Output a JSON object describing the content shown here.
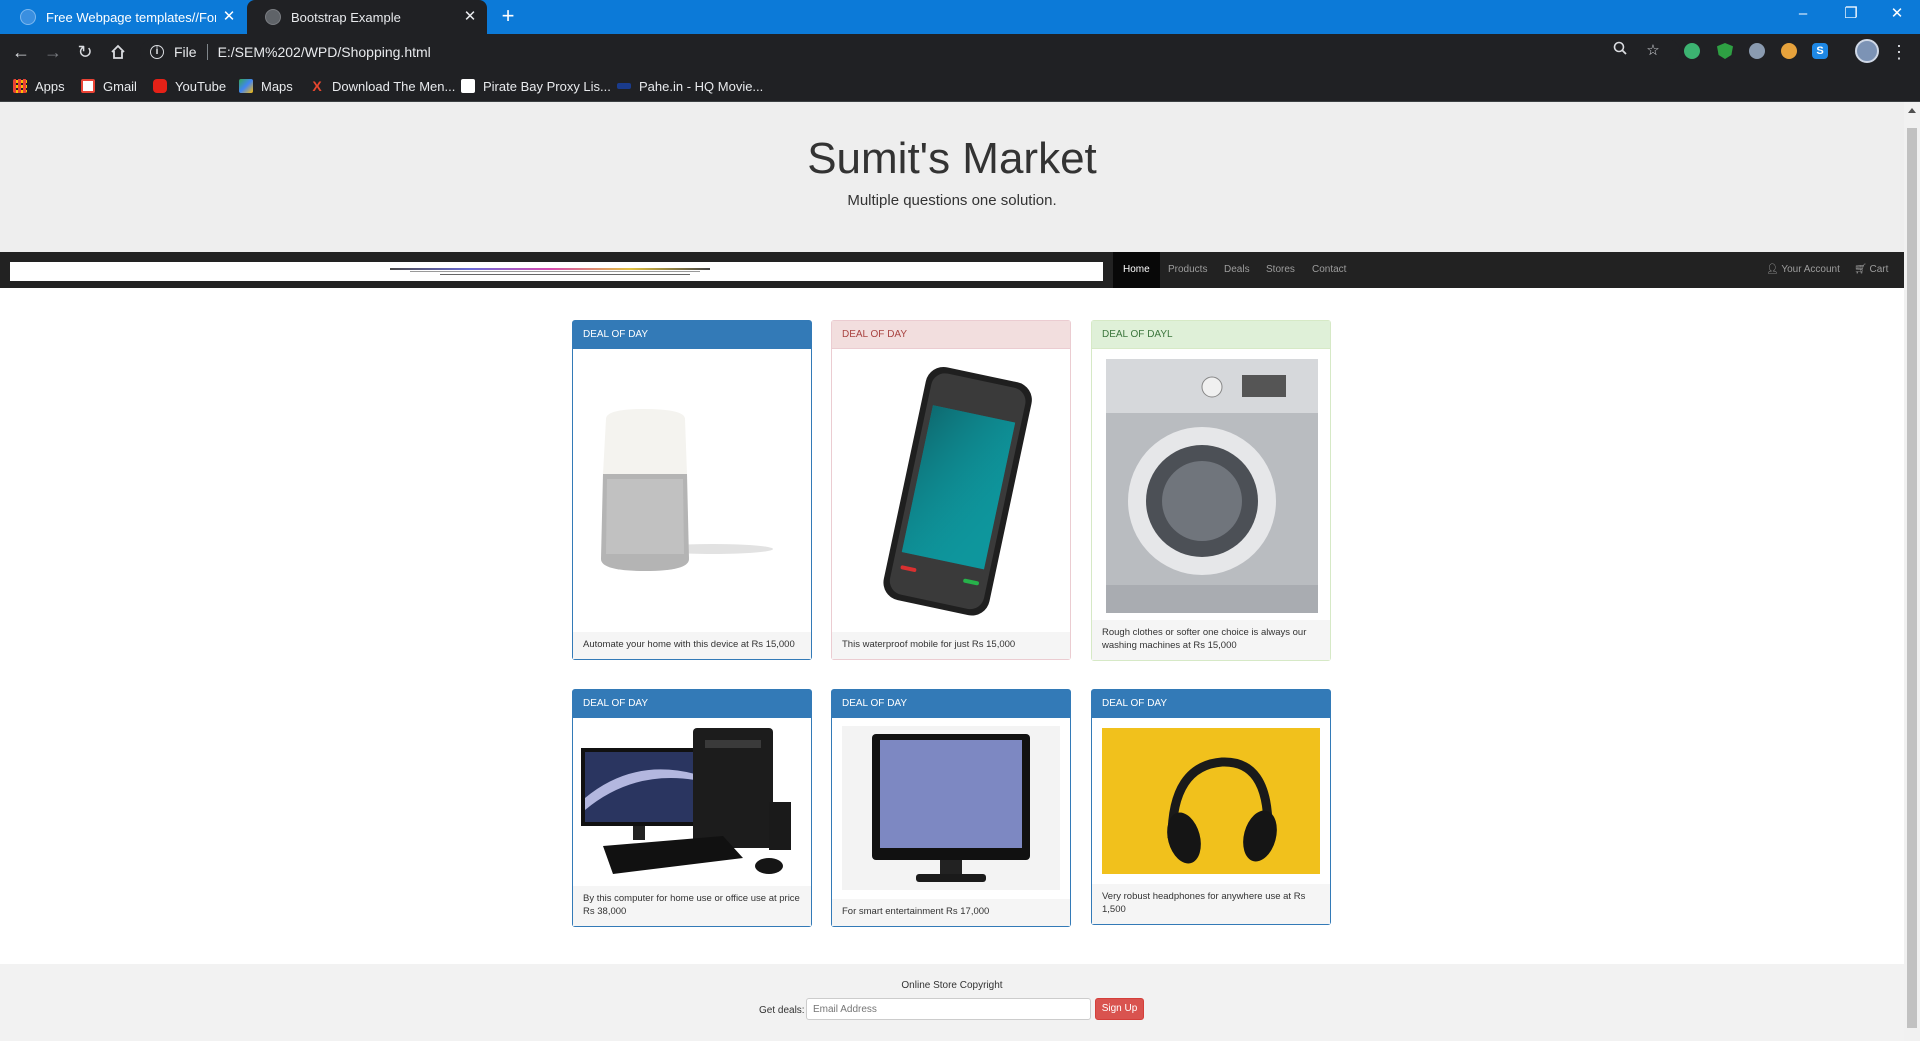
{
  "browser": {
    "tabs": [
      {
        "title": "Free Webpage templates//For ec"
      },
      {
        "title": "Bootstrap Example"
      }
    ],
    "address": {
      "scheme_label": "File",
      "url": "E:/SEM%202/WPD/Shopping.html"
    },
    "bookmarks": [
      {
        "label": "Apps"
      },
      {
        "label": "Gmail"
      },
      {
        "label": "YouTube"
      },
      {
        "label": "Maps"
      },
      {
        "label": "Download The Men..."
      },
      {
        "label": "Pirate Bay Proxy Lis..."
      },
      {
        "label": "Pahe.in - HQ Movie..."
      }
    ]
  },
  "page": {
    "title": "Sumit's Market",
    "subtitle": "Multiple questions one solution.",
    "nav": {
      "links": [
        {
          "label": "Home"
        },
        {
          "label": "Products"
        },
        {
          "label": "Deals"
        },
        {
          "label": "Stores"
        },
        {
          "label": "Contact"
        }
      ],
      "account": "Your Account",
      "cart": "Cart"
    },
    "products": [
      {
        "heading": "DEAL OF DAY",
        "style": "primary",
        "image": "smart-speaker",
        "caption": "Automate your home with this device at Rs 15,000"
      },
      {
        "heading": "DEAL OF DAY",
        "style": "danger",
        "image": "smartphone",
        "caption": "This waterproof mobile for just Rs 15,000"
      },
      {
        "heading": "DEAL OF DAYL",
        "style": "success",
        "image": "washing-machine",
        "caption": "Rough clothes or softer one choice is always our washing machines at Rs 15,000"
      },
      {
        "heading": "DEAL OF DAY",
        "style": "primary",
        "image": "desktop-computer",
        "caption": "By this computer for home use or office use at price Rs 38,000"
      },
      {
        "heading": "DEAL OF DAY",
        "style": "primary",
        "image": "television",
        "caption": "For smart entertainment Rs 17,000"
      },
      {
        "heading": "DEAL OF DAY",
        "style": "primary",
        "image": "headphones",
        "caption": "Very robust headphones for anywhere use at Rs 1,500"
      }
    ],
    "footer": {
      "copyright": "Online Store Copyright",
      "deals_label": "Get deals:",
      "email_placeholder": "Email Address",
      "signup_label": "Sign Up"
    }
  },
  "colors": {
    "chrome_blue": "#0c7ad8",
    "toolbar_dark": "#202124",
    "primary": "#337ab7",
    "danger_bg": "#f2dede",
    "success_bg": "#dff0d8",
    "signup_red": "#d9534f"
  }
}
